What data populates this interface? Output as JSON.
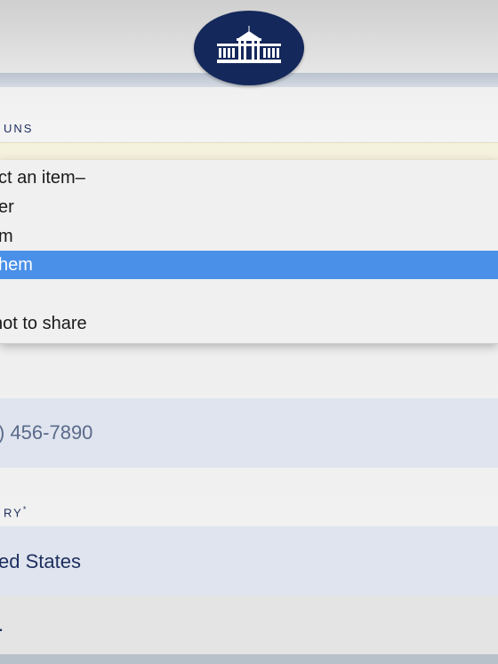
{
  "header": {
    "seal_icon": "white-house-seal-icon"
  },
  "pronouns": {
    "label": "UNS",
    "options": [
      {
        "label": "ct an item–",
        "selected": false
      },
      {
        "label": "er",
        "selected": false
      },
      {
        "label": "m",
        "selected": false
      },
      {
        "label": "hem",
        "selected": true
      },
      {
        "label": "",
        "selected": false
      },
      {
        "label": " not to share",
        "selected": false
      }
    ]
  },
  "phone": {
    "value": ") 456-7890"
  },
  "country": {
    "label": "RY",
    "required_mark": "*",
    "value": "ed States"
  },
  "next_field": {
    "value": "."
  },
  "colors": {
    "seal_bg": "#14285b",
    "label": "#1d2e5e",
    "selected_option_bg": "#4a90e8",
    "field_bg": "#dfe4ee"
  }
}
